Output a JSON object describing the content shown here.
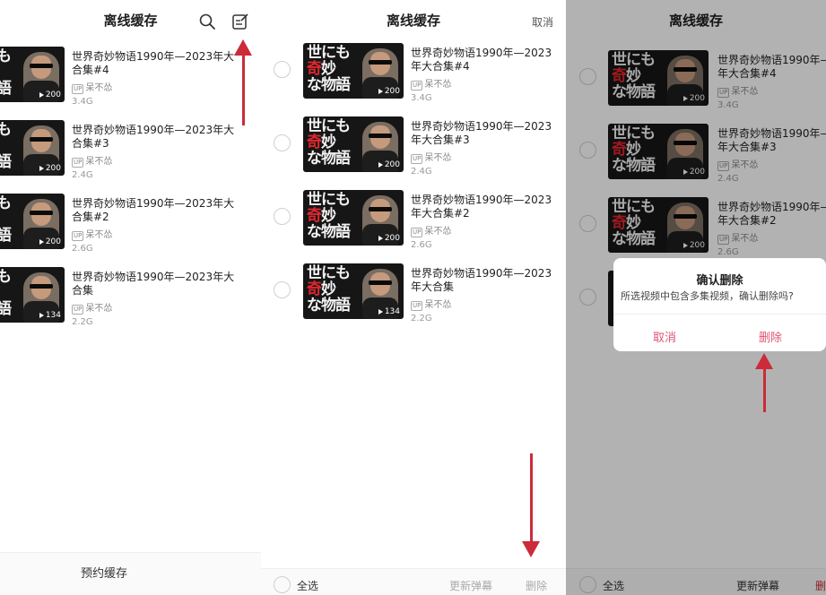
{
  "panel1": {
    "title": "离线缓存",
    "reserve_label": "预约缓存"
  },
  "panel2": {
    "title": "离线缓存",
    "cancel_label": "取消",
    "select_all_label": "全选",
    "update_danmaku_label": "更新弹幕",
    "delete_label": "删除"
  },
  "panel3": {
    "title": "离线缓存",
    "select_all_label": "全选",
    "update_danmaku_label": "更新弹幕",
    "delete_label": "删",
    "dialog": {
      "title": "确认删除",
      "message": "所选视频中包含多集视频，确认删除吗?",
      "cancel_label": "取消",
      "confirm_label": "删除"
    }
  },
  "thumb_text": {
    "line1": "世にも",
    "line2_red": "奇",
    "line2_rest": "妙",
    "line3": "な物語"
  },
  "videos": [
    {
      "title": "世界奇妙物语1990年—2023年大合集#4",
      "title_p3": "世界奇妙物语1990年—",
      "title_p3_line2": "年大合集#4",
      "uploader": "呆不怂",
      "size": "3.4G",
      "count": "200"
    },
    {
      "title": "世界奇妙物语1990年—2023年大合集#3",
      "title_p3": "世界奇妙物语1990年—",
      "title_p3_line2": "年大合集#3",
      "uploader": "呆不怂",
      "size": "2.4G",
      "count": "200"
    },
    {
      "title": "世界奇妙物语1990年—2023年大合集#2",
      "title_p3": "世界奇妙物语1990年—",
      "title_p3_line2": "年大合集#2",
      "uploader": "呆不怂",
      "size": "2.6G",
      "count": "200"
    },
    {
      "title": "世界奇妙物语1990年—2023年大合集",
      "uploader": "呆不怂",
      "size": "2.2G",
      "count": "134"
    }
  ],
  "up_badge": "UP",
  "colors": {
    "accent_red": "#cc2b3a",
    "delete_pink": "#e05573"
  }
}
